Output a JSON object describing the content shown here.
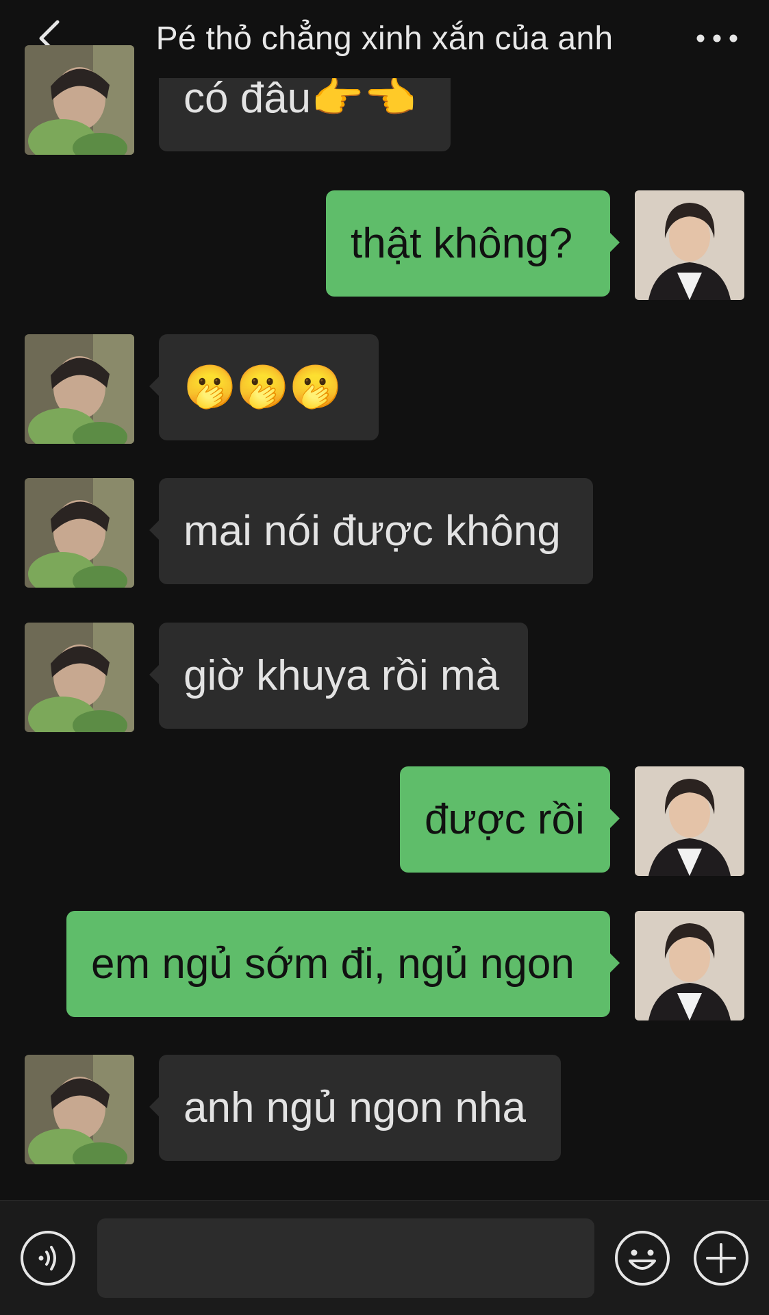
{
  "header": {
    "title": "Pé thỏ chẳng xinh xắn của anh",
    "back_icon": "chevron-left-icon",
    "more_icon": "ellipsis-icon"
  },
  "messages": [
    {
      "side": "in",
      "text": "có đâu👉👈"
    },
    {
      "side": "out",
      "text": "thật không?"
    },
    {
      "side": "in",
      "text": "🫢🫢🫢"
    },
    {
      "side": "in",
      "text": "mai nói được không"
    },
    {
      "side": "in",
      "text": "giờ khuya rồi mà"
    },
    {
      "side": "out",
      "text": "được rồi"
    },
    {
      "side": "out",
      "text": "em ngủ sớm đi, ngủ ngon"
    },
    {
      "side": "in",
      "text": "anh ngủ ngon nha"
    }
  ],
  "input": {
    "value": "",
    "placeholder": ""
  },
  "icons": {
    "voice": "voice-icon",
    "emoji": "emoji-icon",
    "plus": "plus-icon"
  },
  "colors": {
    "background": "#111111",
    "bubble_in": "#2c2c2c",
    "bubble_out": "#5fbd6a",
    "text_light": "#e6e6e6",
    "text_dark": "#111111"
  }
}
